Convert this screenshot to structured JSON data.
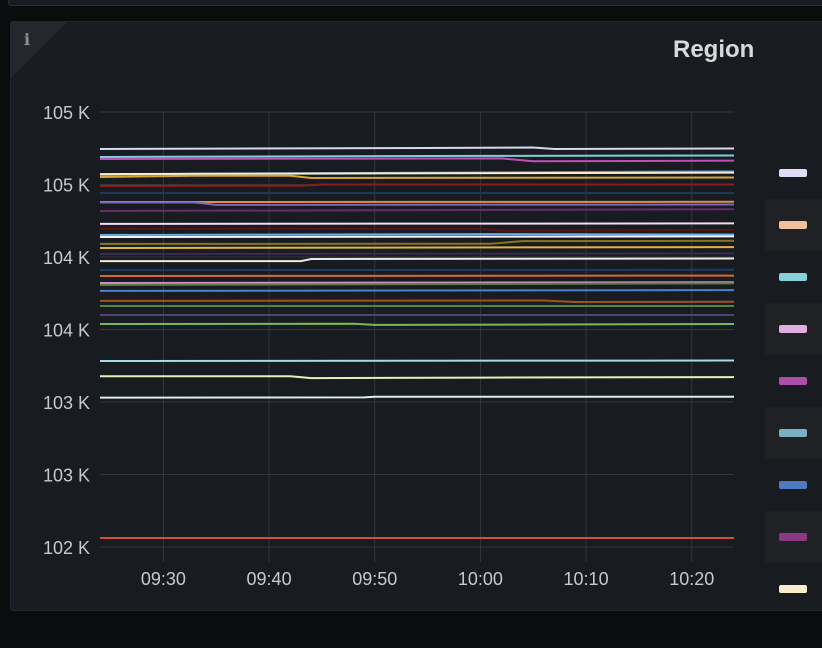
{
  "panel": {
    "title": "Region",
    "info_icon": "info-icon"
  },
  "chart_data": {
    "type": "line",
    "title": "Region",
    "xlabel": "",
    "ylabel": "",
    "xlim": [
      "09:24",
      "10:24"
    ],
    "ylim": [
      102,
      105
    ],
    "y_ticks": [
      {
        "value": 102,
        "label": "102 K"
      },
      {
        "value": 102.5,
        "label": "103 K"
      },
      {
        "value": 103,
        "label": "103 K"
      },
      {
        "value": 103.5,
        "label": "104 K"
      },
      {
        "value": 104,
        "label": "104 K"
      },
      {
        "value": 104.5,
        "label": "105 K"
      },
      {
        "value": 105,
        "label": "105 K"
      }
    ],
    "x_ticks": [
      "09:30",
      "09:40",
      "09:50",
      "10:00",
      "10:10",
      "10:20"
    ],
    "grid": true,
    "legend_position": "right",
    "legend_colors": [
      "#e0dcf8",
      "#f0c09a",
      "#86d0dc",
      "#e0aede",
      "#ad4fa8",
      "#7aafc4",
      "#4f7bbe",
      "#8a3a82",
      "#fbeccd"
    ],
    "series": [
      {
        "color": "#d6d8f0",
        "points": [
          [
            "09:24",
            104.745
          ],
          [
            "09:55",
            104.752
          ],
          [
            "10:05",
            104.755
          ],
          [
            "10:07",
            104.745
          ],
          [
            "10:24",
            104.748
          ]
        ]
      },
      {
        "color": "#7ecfdc",
        "points": [
          [
            "09:24",
            104.69
          ],
          [
            "10:00",
            104.697
          ],
          [
            "10:24",
            104.7
          ]
        ]
      },
      {
        "color": "#c050b4",
        "points": [
          [
            "09:24",
            104.676
          ],
          [
            "10:02",
            104.68
          ],
          [
            "10:05",
            104.66
          ],
          [
            "10:24",
            104.665
          ]
        ]
      },
      {
        "color": "#5d8ed0",
        "points": [
          [
            "09:24",
            104.565
          ],
          [
            "09:33",
            104.575
          ],
          [
            "10:24",
            104.59
          ]
        ]
      },
      {
        "color": "#fbeccd",
        "points": [
          [
            "09:24",
            104.572
          ],
          [
            "10:24",
            104.582
          ]
        ]
      },
      {
        "color": "#d4a830",
        "points": [
          [
            "09:24",
            104.552
          ],
          [
            "09:33",
            104.56
          ],
          [
            "09:42",
            104.56
          ],
          [
            "09:44",
            104.545
          ],
          [
            "10:24",
            104.548
          ]
        ]
      },
      {
        "color": "#8a1e1a",
        "points": [
          [
            "09:24",
            104.49
          ],
          [
            "09:43",
            104.492
          ],
          [
            "09:45",
            104.5
          ],
          [
            "10:24",
            104.5
          ]
        ]
      },
      {
        "color": "#1c3a5c",
        "points": [
          [
            "09:24",
            104.441
          ],
          [
            "10:24",
            104.441
          ]
        ]
      },
      {
        "color": "#e08a4c",
        "points": [
          [
            "09:24",
            104.379
          ],
          [
            "10:24",
            104.381
          ]
        ]
      },
      {
        "color": "#7a68b8",
        "points": [
          [
            "09:24",
            104.376
          ],
          [
            "09:33",
            104.376
          ],
          [
            "09:35",
            104.359
          ],
          [
            "10:24",
            104.362
          ]
        ]
      },
      {
        "color": "#6a2a70",
        "points": [
          [
            "09:24",
            104.317
          ],
          [
            "10:24",
            104.33
          ]
        ]
      },
      {
        "color": "#f4dcf4",
        "points": [
          [
            "09:24",
            104.228
          ],
          [
            "10:24",
            104.232
          ]
        ]
      },
      {
        "color": "#5a1410",
        "points": [
          [
            "09:24",
            104.195
          ],
          [
            "10:00",
            104.195
          ],
          [
            "10:02",
            104.182
          ],
          [
            "10:24",
            104.186
          ]
        ]
      },
      {
        "color": "#6aaae8",
        "points": [
          [
            "09:24",
            104.152
          ],
          [
            "10:01",
            104.158
          ],
          [
            "10:24",
            104.155
          ]
        ]
      },
      {
        "color": "#f4f4f4",
        "points": [
          [
            "09:24",
            104.138
          ],
          [
            "10:24",
            104.142
          ]
        ]
      },
      {
        "color": "#8a7420",
        "points": [
          [
            "09:24",
            104.09
          ],
          [
            "10:01",
            104.092
          ],
          [
            "10:04",
            104.11
          ],
          [
            "10:24",
            104.112
          ]
        ]
      },
      {
        "color": "#e0b440",
        "points": [
          [
            "09:24",
            104.062
          ],
          [
            "10:24",
            104.068
          ]
        ]
      },
      {
        "color": "#3a2c50",
        "points": [
          [
            "09:24",
            104.021
          ],
          [
            "10:24",
            104.025
          ]
        ]
      },
      {
        "color": "#f0e8dc",
        "points": [
          [
            "09:24",
            103.972
          ],
          [
            "09:43",
            103.972
          ],
          [
            "09:44",
            103.986
          ],
          [
            "10:24",
            103.99
          ]
        ]
      },
      {
        "color": "#1e3a66",
        "points": [
          [
            "09:24",
            103.91
          ],
          [
            "10:24",
            103.912
          ]
        ]
      },
      {
        "color": "#d86a30",
        "points": [
          [
            "09:24",
            103.869
          ],
          [
            "10:24",
            103.872
          ]
        ]
      },
      {
        "color": "#c890c8",
        "points": [
          [
            "09:24",
            103.821
          ],
          [
            "10:24",
            103.826
          ]
        ]
      },
      {
        "color": "#5a7a48",
        "points": [
          [
            "09:24",
            103.807
          ],
          [
            "10:24",
            103.818
          ]
        ]
      },
      {
        "color": "#4a82d0",
        "points": [
          [
            "09:24",
            103.766
          ],
          [
            "10:24",
            103.772
          ]
        ]
      },
      {
        "color": "#a0521e",
        "points": [
          [
            "09:24",
            103.697
          ],
          [
            "10:06",
            103.7
          ],
          [
            "10:09",
            103.69
          ],
          [
            "10:24",
            103.692
          ]
        ]
      },
      {
        "color": "#4a8a3a",
        "points": [
          [
            "09:24",
            103.662
          ],
          [
            "10:24",
            103.662
          ]
        ]
      },
      {
        "color": "#4e4470",
        "points": [
          [
            "09:24",
            103.6
          ],
          [
            "10:24",
            103.6
          ]
        ]
      },
      {
        "color": "#7ab858",
        "points": [
          [
            "09:24",
            103.538
          ],
          [
            "09:48",
            103.54
          ],
          [
            "09:50",
            103.532
          ],
          [
            "10:24",
            103.538
          ]
        ]
      },
      {
        "color": "#a8d8ec",
        "points": [
          [
            "09:24",
            103.283
          ],
          [
            "10:24",
            103.286
          ]
        ]
      },
      {
        "color": "#e4f0b8",
        "points": [
          [
            "09:24",
            103.178
          ],
          [
            "09:42",
            103.178
          ],
          [
            "09:44",
            103.165
          ],
          [
            "10:00",
            103.168
          ],
          [
            "10:24",
            103.172
          ]
        ]
      },
      {
        "color": "#dcecf4",
        "points": [
          [
            "09:24",
            103.03
          ],
          [
            "09:49",
            103.032
          ],
          [
            "09:50",
            103.036
          ],
          [
            "10:24",
            103.036
          ]
        ]
      },
      {
        "color": "#d0503c",
        "points": [
          [
            "09:24",
            102.062
          ],
          [
            "10:24",
            102.062
          ]
        ]
      }
    ]
  }
}
